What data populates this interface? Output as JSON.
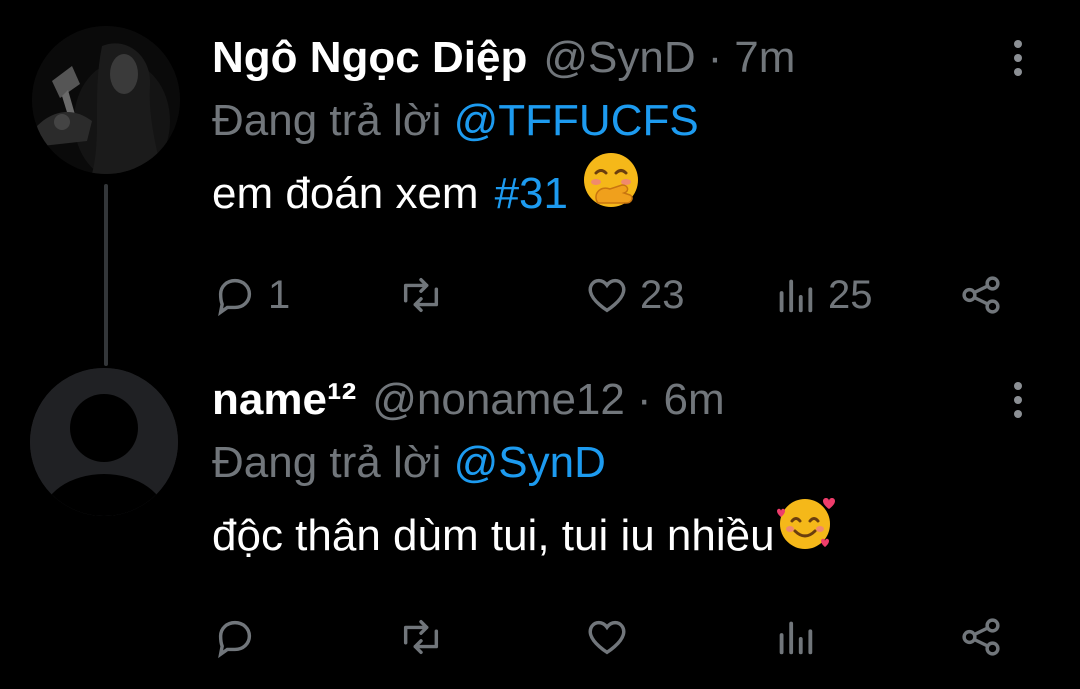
{
  "tweets": [
    {
      "display_name": "Ngô Ngọc Diệp",
      "handle": "@SynD",
      "separator": "·",
      "time": "7m",
      "reply_prefix": "Đang trả lời",
      "reply_to": "@TFFUCFS",
      "text": "em đoán xem",
      "hashtag": "#31",
      "emoji": "hand-over-mouth-smile-emoji",
      "actions": {
        "replies": "1",
        "retweets": "",
        "likes": "23",
        "views": "25"
      }
    },
    {
      "display_name": "name¹²",
      "handle": "@noname12",
      "separator": "·",
      "time": "6m",
      "reply_prefix": "Đang trả lời",
      "reply_to": "@SynD",
      "text": "độc thân dùm tui, tui iu nhiều",
      "emoji": "smiling-face-with-hearts-emoji",
      "actions": {
        "replies": "",
        "retweets": "",
        "likes": "",
        "views": ""
      }
    }
  ],
  "icons": [
    "reply-icon",
    "retweet-icon",
    "like-icon",
    "views-icon",
    "share-icon",
    "more-options-icon"
  ],
  "colors": {
    "background": "#000000",
    "text": "#ffffff",
    "muted": "#71767b",
    "link": "#1d9bf0",
    "thread_line": "#333639"
  }
}
